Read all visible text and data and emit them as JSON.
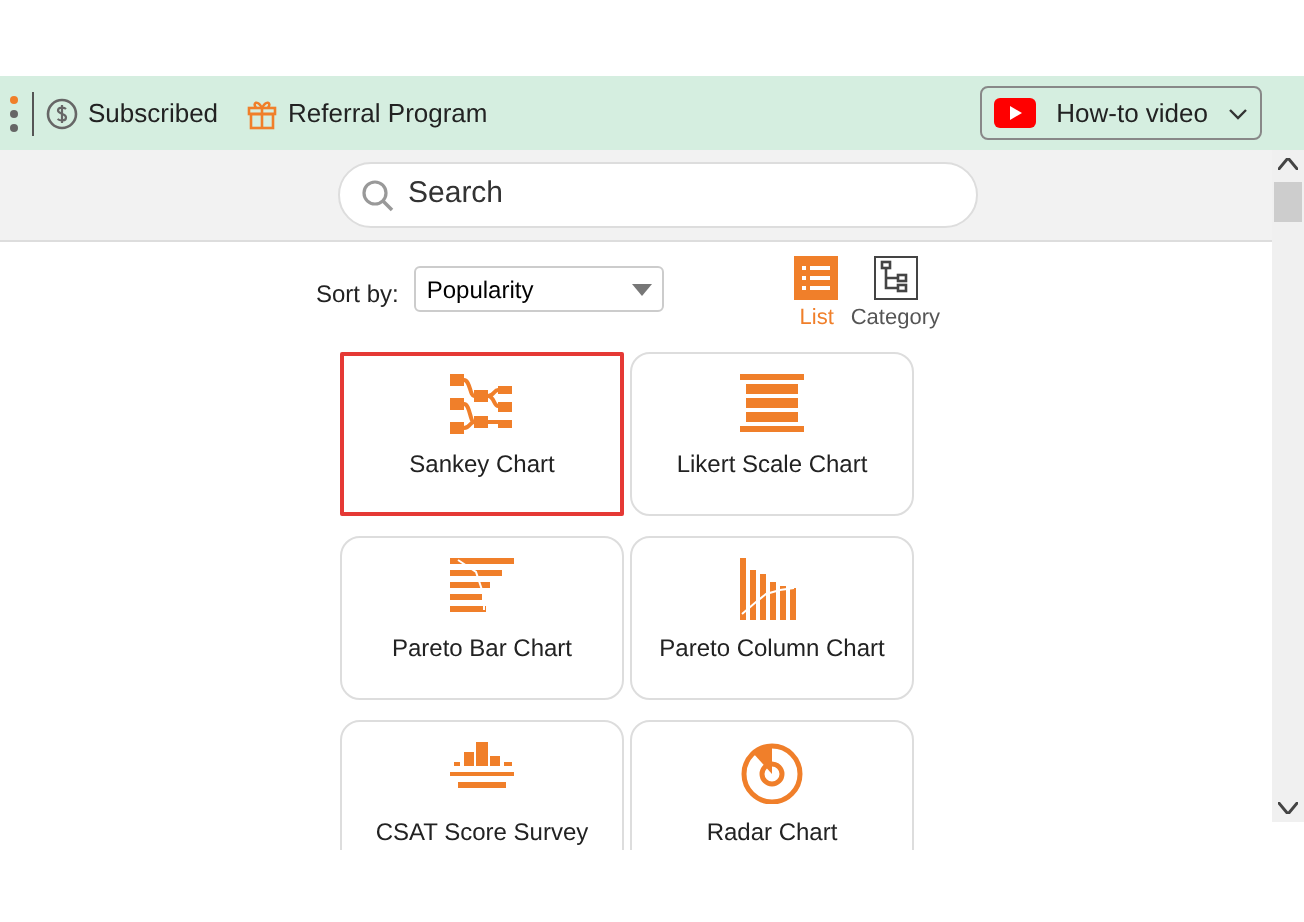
{
  "toolbar": {
    "items": [
      {
        "kind": "subscribed",
        "label": "Subscribed"
      },
      {
        "kind": "gift",
        "label": "Referral Program"
      }
    ],
    "video_button": {
      "label": "How-to video"
    }
  },
  "search": {
    "placeholder": "Search"
  },
  "sort": {
    "label": "Sort by:",
    "value": "Popularity"
  },
  "views": [
    {
      "kind": "list",
      "label": "List",
      "selected": true
    },
    {
      "kind": "category",
      "label": "Category",
      "selected": false
    }
  ],
  "charts": [
    {
      "kind": "sankey",
      "label": "Sankey Chart",
      "selected": true
    },
    {
      "kind": "likert",
      "label": "Likert Scale Chart",
      "selected": false
    },
    {
      "kind": "pareto-bar",
      "label": "Pareto Bar Chart",
      "selected": false
    },
    {
      "kind": "pareto-column",
      "label": "Pareto Column Chart",
      "selected": false
    },
    {
      "kind": "csat",
      "label": "CSAT Score Survey",
      "selected": false
    },
    {
      "kind": "radar",
      "label": "Radar Chart",
      "selected": false
    }
  ]
}
